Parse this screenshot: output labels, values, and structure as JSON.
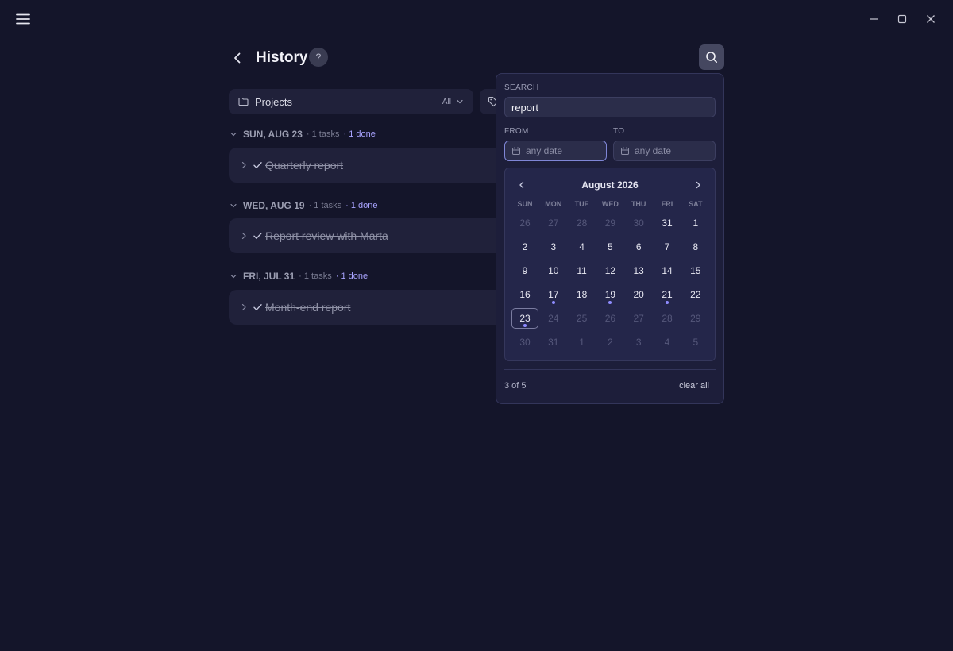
{
  "header": {
    "title": "History",
    "help_label": "?"
  },
  "filters": {
    "projects_label": "Projects",
    "projects_value": "All"
  },
  "groups": [
    {
      "date": "SUN, AUG 23",
      "count": "· 1 tasks",
      "done": "· 1 done",
      "task": "Quarterly report"
    },
    {
      "date": "WED, AUG 19",
      "count": "· 1 tasks",
      "done": "· 1 done",
      "task": "Report review with Marta"
    },
    {
      "date": "FRI, JUL 31",
      "count": "· 1 tasks",
      "done": "· 1 done",
      "task": "Month-end report"
    }
  ],
  "search_panel": {
    "search_label": "SEARCH",
    "search_value": "report",
    "from_label": "FROM",
    "to_label": "TO",
    "from_placeholder": "any date",
    "to_placeholder": "any date",
    "result_count": "3 of 5",
    "clear_label": "clear all"
  },
  "calendar": {
    "month_label": "August 2026",
    "weekdays": [
      "SUN",
      "MON",
      "TUE",
      "WED",
      "THU",
      "FRI",
      "SAT"
    ],
    "today": 23,
    "days_with_tasks": [
      17,
      19,
      21,
      23
    ],
    "weeks": [
      [
        {
          "d": "26",
          "dim": true
        },
        {
          "d": "27",
          "dim": true
        },
        {
          "d": "28",
          "dim": true
        },
        {
          "d": "29",
          "dim": true
        },
        {
          "d": "30",
          "dim": true
        },
        {
          "d": "31"
        },
        {
          "d": "1"
        }
      ],
      [
        {
          "d": "2"
        },
        {
          "d": "3"
        },
        {
          "d": "4"
        },
        {
          "d": "5"
        },
        {
          "d": "6"
        },
        {
          "d": "7"
        },
        {
          "d": "8"
        }
      ],
      [
        {
          "d": "9"
        },
        {
          "d": "10"
        },
        {
          "d": "11"
        },
        {
          "d": "12"
        },
        {
          "d": "13"
        },
        {
          "d": "14"
        },
        {
          "d": "15"
        }
      ],
      [
        {
          "d": "16"
        },
        {
          "d": "17",
          "dot": true
        },
        {
          "d": "18"
        },
        {
          "d": "19",
          "dot": true
        },
        {
          "d": "20"
        },
        {
          "d": "21",
          "dot": true
        },
        {
          "d": "22"
        }
      ],
      [
        {
          "d": "23",
          "dot": true,
          "today": true
        },
        {
          "d": "24",
          "dim": true
        },
        {
          "d": "25",
          "dim": true
        },
        {
          "d": "26",
          "dim": true
        },
        {
          "d": "27",
          "dim": true
        },
        {
          "d": "28",
          "dim": true
        },
        {
          "d": "29",
          "dim": true
        }
      ],
      [
        {
          "d": "30",
          "dim": true
        },
        {
          "d": "31",
          "dim": true
        },
        {
          "d": "1",
          "dim": true
        },
        {
          "d": "2",
          "dim": true
        },
        {
          "d": "3",
          "dim": true
        },
        {
          "d": "4",
          "dim": true
        },
        {
          "d": "5",
          "dim": true
        }
      ]
    ]
  },
  "colors": {
    "background": "#14152a",
    "card": "#20213a",
    "accent": "#a9a4ff",
    "dot": "#8f8cff"
  }
}
